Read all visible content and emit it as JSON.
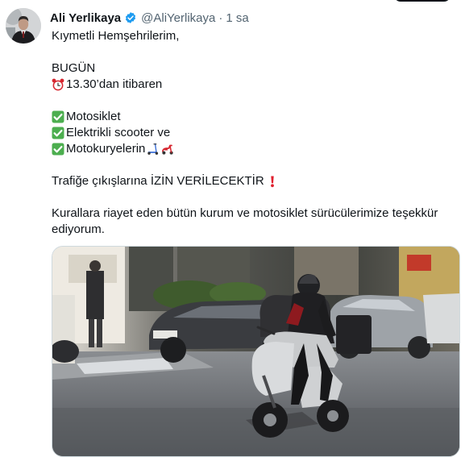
{
  "tweet": {
    "author_name": "Ali Yerlikaya",
    "author_handle": "@AliYerlikaya",
    "separator": "·",
    "time": "1 sa",
    "lines": {
      "greeting": "Kıymetli Hemşehrilerim,",
      "today": "BUGÜN",
      "time_note": "13.30’dan itibaren",
      "item1": "Motosiklet",
      "item2": "Elektrikli scooter ve",
      "item3": "Motokuryelerin",
      "announcement": "Trafiğe çıkışlarına İZİN VERİLECEKTİR",
      "thanks": "Kurallara riayet eden bütün kurum ve motosiklet sürücülerimize teşekkür ediyorum."
    },
    "icons": {
      "verified": "verified-badge-icon",
      "clock": "alarm-clock-icon",
      "check": "check-mark-button-icon",
      "scooter": "kick-scooter-icon",
      "motor_scooter": "motor-scooter-icon",
      "exclamation": "red-exclamation-icon"
    },
    "colors": {
      "accent": "#1d9bf0",
      "check_green": "#4cae4f",
      "exclamation_red": "#e0202f",
      "muted": "#536471"
    }
  }
}
